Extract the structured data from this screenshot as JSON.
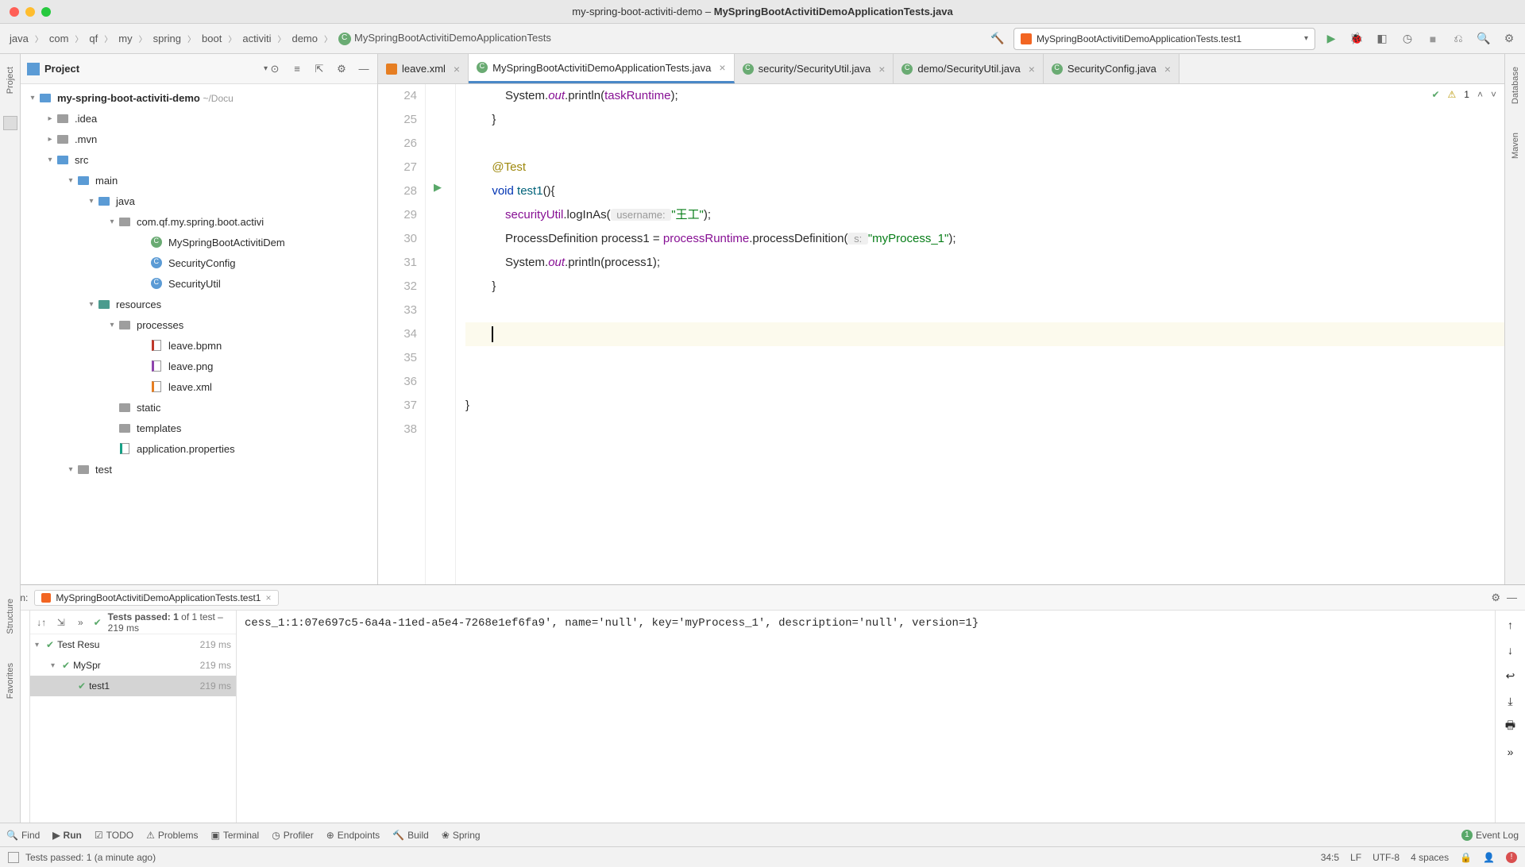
{
  "window": {
    "title_project": "my-spring-boot-activiti-demo",
    "title_file": "MySpringBootActivitiDemoApplicationTests.java"
  },
  "breadcrumb": [
    "java",
    "com",
    "qf",
    "my",
    "spring",
    "boot",
    "activiti",
    "demo"
  ],
  "breadcrumb_class": "MySpringBootActivitiDemoApplicationTests",
  "run_config": "MySpringBootActivitiDemoApplicationTests.test1",
  "project_panel": {
    "title": "Project",
    "root": "my-spring-boot-activiti-demo",
    "root_path": "~/Docu",
    "nodes": {
      "idea": ".idea",
      "mvn": ".mvn",
      "src": "src",
      "main": "main",
      "java": "java",
      "pkg": "com.qf.my.spring.boot.activi",
      "cls_app": "MySpringBootActivitiDem",
      "cls_sec_cfg": "SecurityConfig",
      "cls_sec_util": "SecurityUtil",
      "resources": "resources",
      "processes": "processes",
      "leave_bpmn": "leave.bpmn",
      "leave_png": "leave.png",
      "leave_xml": "leave.xml",
      "static": "static",
      "templates": "templates",
      "app_props": "application.properties",
      "test": "test"
    }
  },
  "tabs": [
    {
      "label": "leave.xml",
      "type": "xml"
    },
    {
      "label": "MySpringBootActivitiDemoApplicationTests.java",
      "type": "class",
      "active": true
    },
    {
      "label": "security/SecurityUtil.java",
      "type": "class"
    },
    {
      "label": "demo/SecurityUtil.java",
      "type": "class"
    },
    {
      "label": "SecurityConfig.java",
      "type": "class"
    }
  ],
  "editor": {
    "warning_count": "1",
    "lines": {
      "24": {
        "indent": 3,
        "segments": [
          "System.",
          {
            "t": "out",
            "c": "static"
          },
          ".println(",
          {
            "t": "taskRuntime",
            "c": "field"
          },
          ");"
        ]
      },
      "25": {
        "indent": 2,
        "segments": [
          "}"
        ]
      },
      "27": {
        "indent": 2,
        "segments": [
          {
            "t": "@Test",
            "c": "ann"
          }
        ]
      },
      "28": {
        "indent": 2,
        "segments": [
          {
            "t": "void ",
            "c": "kw"
          },
          {
            "t": "test1",
            "c": "method"
          },
          "(){"
        ]
      },
      "29": {
        "indent": 3,
        "segments": [
          {
            "t": "securityUtil",
            "c": "field"
          },
          ".logInAs(",
          {
            "t": " username: ",
            "c": "param-hint"
          },
          {
            "t": "\"王工\"",
            "c": "str"
          },
          ");"
        ]
      },
      "30": {
        "indent": 3,
        "segments": [
          "ProcessDefinition process1 = ",
          {
            "t": "processRuntime",
            "c": "field"
          },
          ".processDefinition(",
          {
            "t": " s: ",
            "c": "param-hint"
          },
          {
            "t": "\"myProcess_1\"",
            "c": "str"
          },
          ");"
        ]
      },
      "31": {
        "indent": 3,
        "segments": [
          "System.",
          {
            "t": "out",
            "c": "static"
          },
          ".println(process1);"
        ]
      },
      "32": {
        "indent": 2,
        "segments": [
          "}"
        ]
      },
      "34": {
        "indent": 2,
        "segments": [],
        "cursor": true
      },
      "37": {
        "indent": 0,
        "segments": [
          "}"
        ]
      }
    },
    "line_numbers": [
      24,
      25,
      26,
      27,
      28,
      29,
      30,
      31,
      32,
      33,
      34,
      35,
      36,
      37,
      38
    ]
  },
  "run_panel": {
    "label": "Run:",
    "tab": "MySpringBootActivitiDemoApplicationTests.test1",
    "tests_passed": "Tests passed: 1",
    "tests_total": " of 1 test – 219 ms",
    "tree": [
      {
        "name": "Test Resu",
        "time": "219 ms",
        "indent": 0
      },
      {
        "name": "MySpr",
        "time": "219 ms",
        "indent": 1
      },
      {
        "name": "test1",
        "time": "219 ms",
        "indent": 2,
        "selected": true
      }
    ],
    "console": "cess_1:1:07e697c5-6a4a-11ed-a5e4-7268e1ef6fa9', name='null', key='myProcess_1', description='null', version=1}"
  },
  "bottom_tools": {
    "find": "Find",
    "run": "Run",
    "todo": "TODO",
    "problems": "Problems",
    "terminal": "Terminal",
    "profiler": "Profiler",
    "endpoints": "Endpoints",
    "build": "Build",
    "spring": "Spring",
    "event_log": "Event Log",
    "event_count": "1"
  },
  "status_bar": {
    "message": "Tests passed: 1 (a minute ago)",
    "caret": "34:5",
    "line_sep": "LF",
    "encoding": "UTF-8",
    "indent": "4 spaces"
  }
}
